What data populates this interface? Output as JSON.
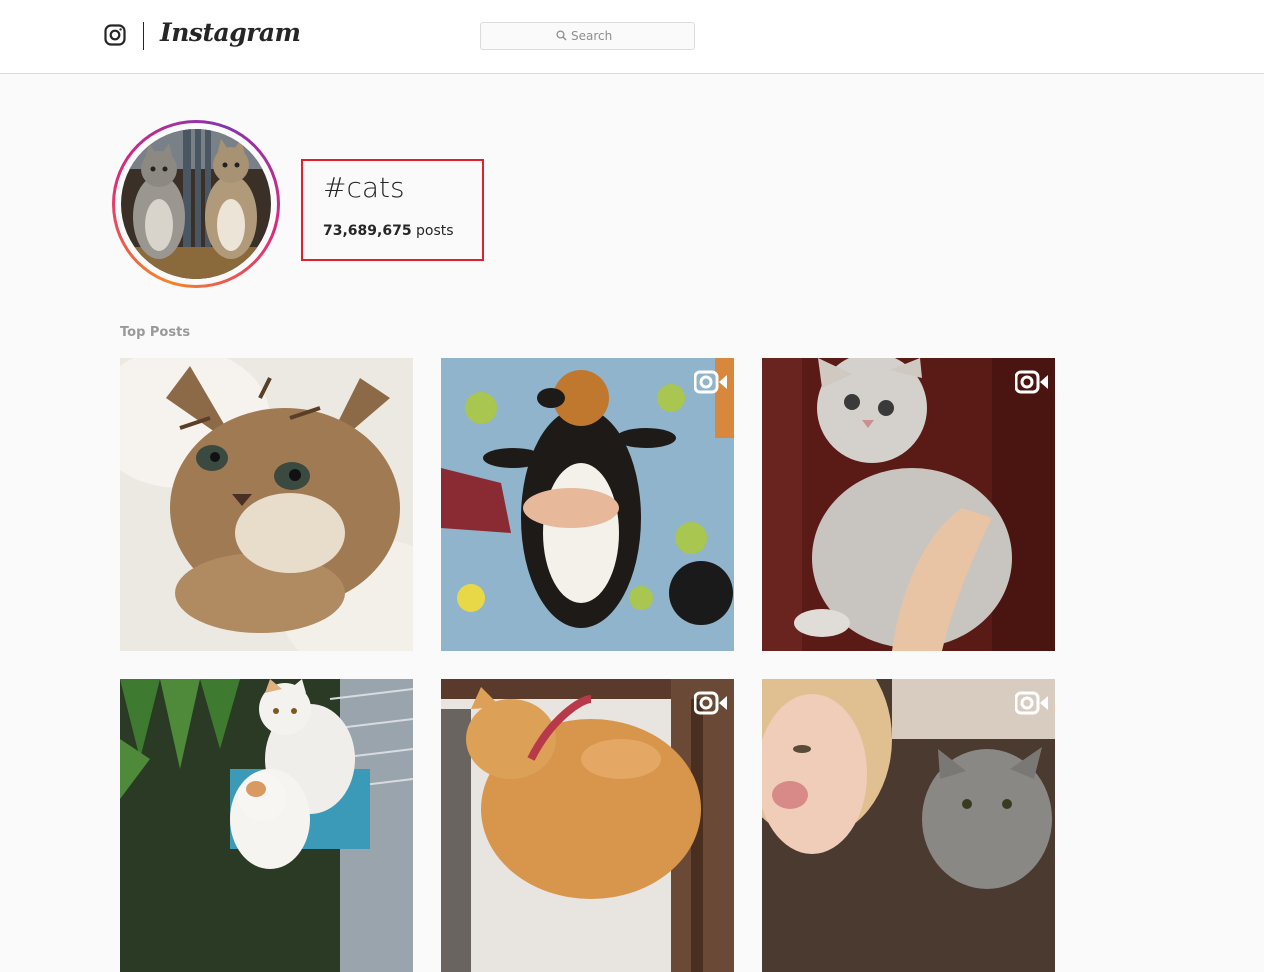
{
  "header": {
    "logo_wordmark": "Instagram",
    "search": {
      "placeholder": "Search",
      "value": ""
    },
    "icons": [
      "instagram-glyph-icon",
      "search-icon"
    ]
  },
  "hashtag": {
    "title": "#cats",
    "post_count": "73,689,675",
    "post_count_suffix": "posts"
  },
  "top_posts": {
    "label": "Top Posts",
    "items": [
      {
        "subject": "tabby-kitten",
        "is_video": false
      },
      {
        "subject": "calico-cat-belly-rub",
        "is_video": true
      },
      {
        "subject": "fluffy-grey-kitten",
        "is_video": true
      },
      {
        "subject": "two-white-cats",
        "is_video": false
      },
      {
        "subject": "orange-cat",
        "is_video": true
      },
      {
        "subject": "girl-with-grey-cat",
        "is_video": true
      }
    ]
  },
  "colors": {
    "highlight_border": "#e0202a",
    "ring_gradient": [
      "#f58529",
      "#dd2a7b",
      "#8134af"
    ],
    "background": "#fafafa",
    "header_bg": "#ffffff",
    "text": "#262626",
    "muted_text": "#999999"
  }
}
